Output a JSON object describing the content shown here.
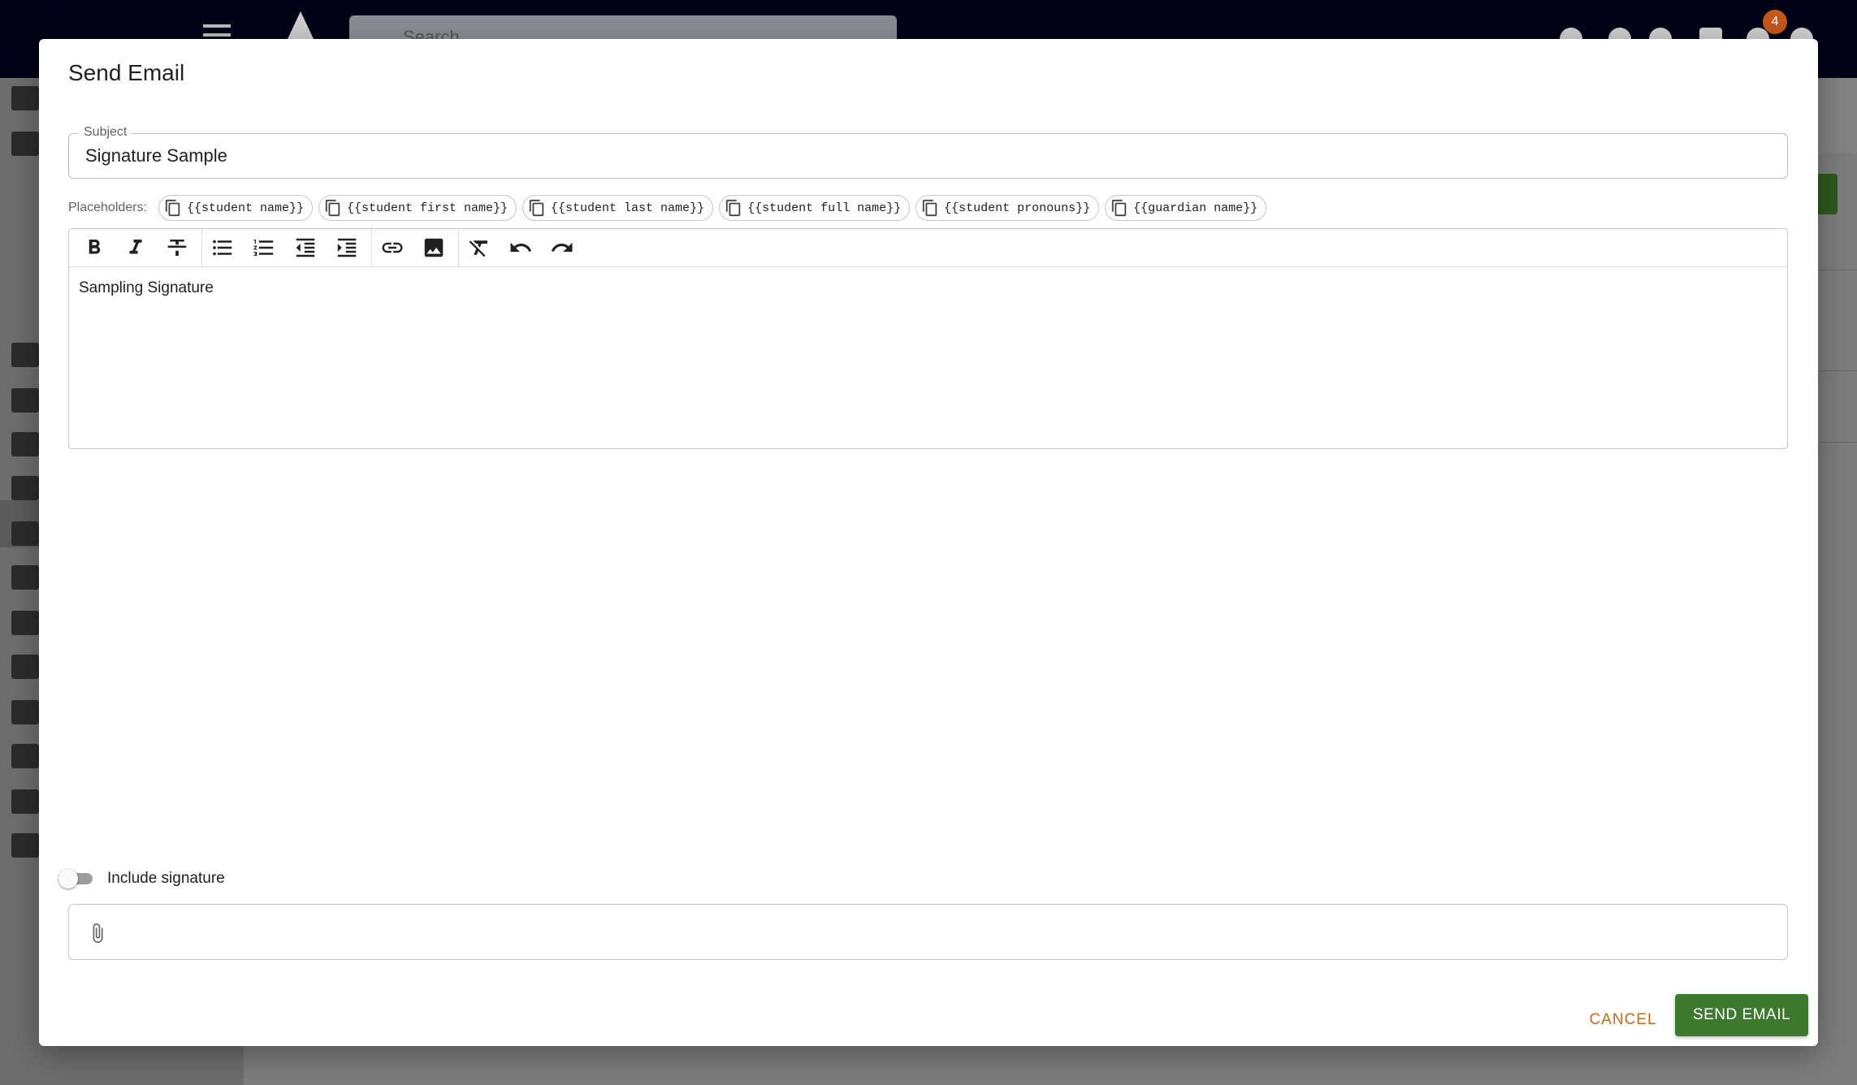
{
  "background": {
    "search_placeholder": "Search",
    "notification_count": "4"
  },
  "dialog": {
    "title": "Send Email",
    "subject": {
      "label": "Subject",
      "value": "Signature Sample"
    },
    "placeholders": {
      "label": "Placeholders:",
      "items": [
        "{{student name}}",
        "{{student first name}}",
        "{{student last name}}",
        "{{student full name}}",
        "{{student pronouns}}",
        "{{guardian name}}"
      ]
    },
    "toolbar": [
      {
        "name": "bold-icon"
      },
      {
        "name": "italic-icon"
      },
      {
        "name": "strikethrough-icon"
      },
      {
        "name": "bulleted-list-icon"
      },
      {
        "name": "numbered-list-icon"
      },
      {
        "name": "outdent-icon"
      },
      {
        "name": "indent-icon"
      },
      {
        "name": "link-icon"
      },
      {
        "name": "image-icon"
      },
      {
        "name": "clear-format-icon"
      },
      {
        "name": "undo-icon"
      },
      {
        "name": "redo-icon"
      }
    ],
    "editor_text": "Sampling Signature",
    "include_signature": {
      "label": "Include signature",
      "checked": false
    },
    "attachment_icon": "paperclip-icon",
    "cancel_label": "CANCEL",
    "send_label": "SEND EMAIL"
  },
  "colors": {
    "send_button": "#3e7a2e",
    "cancel_text": "#c46b1a",
    "topbar": "#030318",
    "badge": "#c4581b"
  }
}
